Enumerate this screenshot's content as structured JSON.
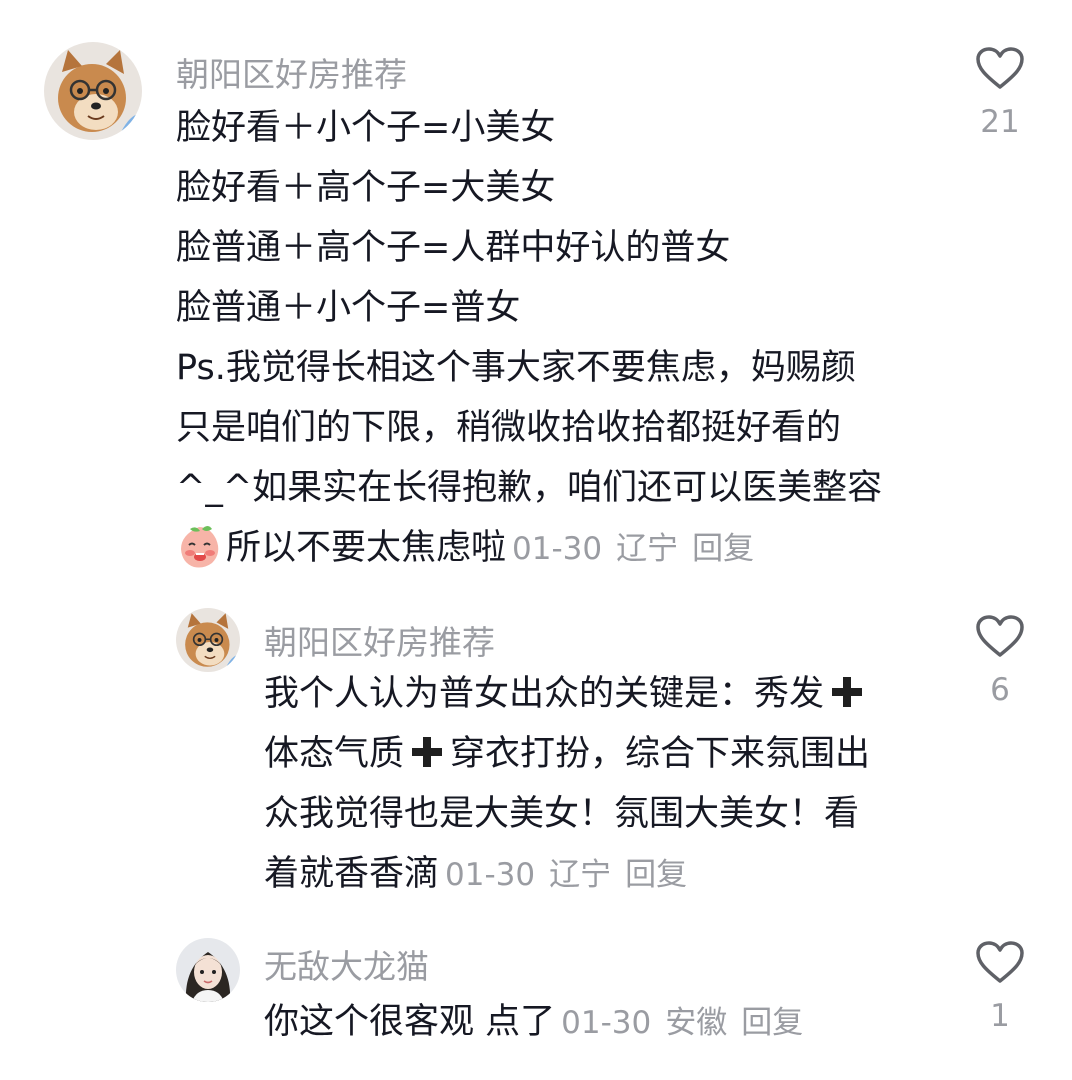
{
  "comments": [
    {
      "username": "朝阳区好房推荐",
      "avatar": "shiba-dog-with-glasses",
      "lines": [
        "脸好看＋小个子=小美女",
        "脸好看＋高个子=大美女",
        "脸普通＋高个子=人群中好认的普女",
        "脸普通＋小个子=普女",
        "Ps.我觉得长相这个事大家不要焦虑，妈赐颜",
        "只是咱们的下限，稍微收拾收拾都挺好看的",
        "^_^如果实在长得抱歉，咱们还可以医美整容"
      ],
      "last_line_emoji": "peach-face-emoji",
      "last_line": "所以不要太焦虑啦",
      "date": "01-30",
      "location": "辽宁",
      "reply_label": "回复",
      "likes": "21"
    },
    {
      "username": "朝阳区好房推荐",
      "avatar": "shiba-dog-with-glasses",
      "line1_a": "我个人认为普女出众的关键是：秀发",
      "line2_a": "体态气质",
      "line2_b": "穿衣打扮，综合下来氛围出",
      "line3": "众我觉得也是大美女！氛围大美女！看",
      "line4": "着就香香滴",
      "plus_icon": "heavy-plus-icon",
      "date": "01-30",
      "location": "辽宁",
      "reply_label": "回复",
      "likes": "6"
    },
    {
      "username": "无敌大龙猫",
      "avatar": "girl-portrait",
      "text": "你这个很客观 点了",
      "date": "01-30",
      "location": "安徽",
      "reply_label": "回复",
      "likes": "1"
    }
  ],
  "colors": {
    "text": "#161823",
    "muted": "#9a9ca2",
    "background": "#ffffff"
  }
}
